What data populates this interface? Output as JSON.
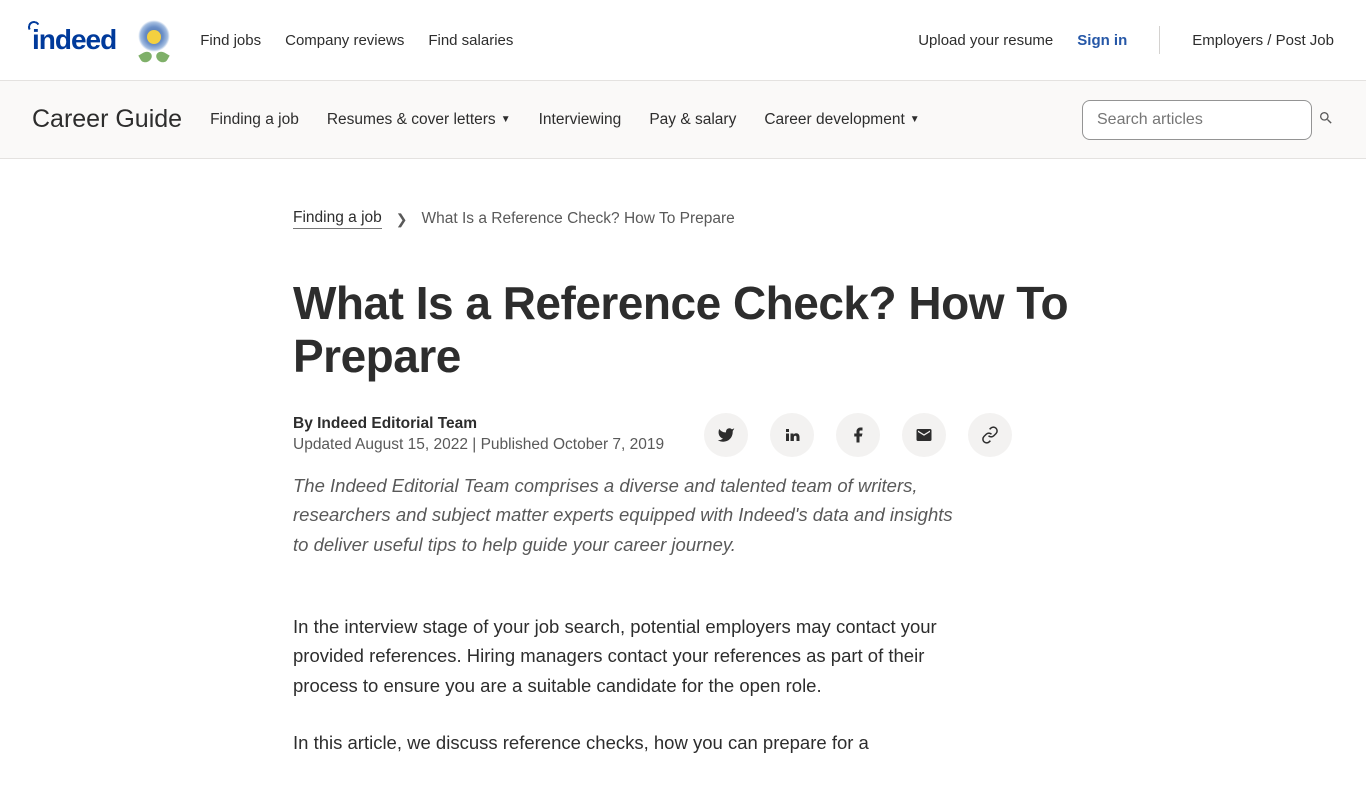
{
  "topnav": {
    "logo_text": "indeed",
    "links": [
      "Find jobs",
      "Company reviews",
      "Find salaries"
    ],
    "upload": "Upload your resume",
    "signin": "Sign in",
    "employers": "Employers / Post Job"
  },
  "subnav": {
    "title": "Career Guide",
    "items": [
      {
        "label": "Finding a job",
        "dropdown": false
      },
      {
        "label": "Resumes & cover letters",
        "dropdown": true
      },
      {
        "label": "Interviewing",
        "dropdown": false
      },
      {
        "label": "Pay & salary",
        "dropdown": false
      },
      {
        "label": "Career development",
        "dropdown": true
      }
    ],
    "search_placeholder": "Search articles"
  },
  "breadcrumb": {
    "parent": "Finding a job",
    "current": "What Is a Reference Check? How To Prepare"
  },
  "article": {
    "title": "What Is a Reference Check? How To Prepare",
    "byline": "By Indeed Editorial Team",
    "dates": "Updated August 15, 2022 | Published October 7, 2019",
    "blurb": "The Indeed Editorial Team comprises a diverse and talented team of writers, researchers and subject matter experts equipped with Indeed's data and insights to deliver useful tips to help guide your career journey.",
    "para1": "In the interview stage of your job search, potential employers may contact your provided references. Hiring managers contact your references as part of their process to ensure you are a suitable candidate for the open role.",
    "para2": "In this article, we discuss reference checks, how you can prepare for a"
  }
}
